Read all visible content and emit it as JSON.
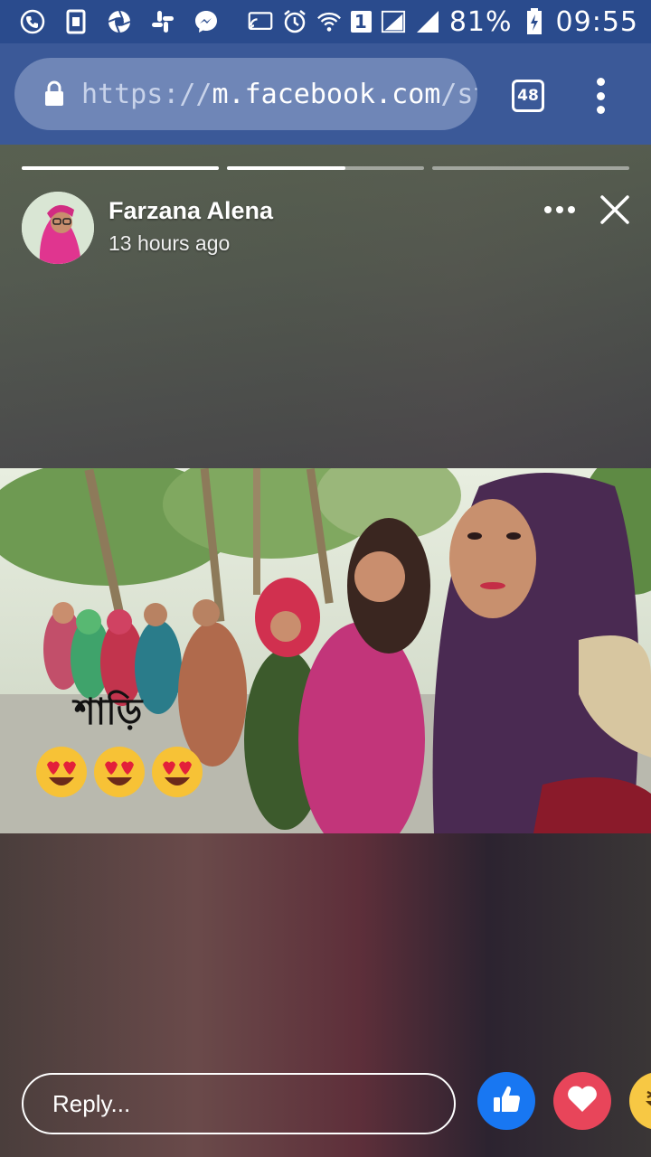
{
  "status_bar": {
    "battery": "81%",
    "time": "09:55",
    "sim_slot": "1"
  },
  "browser": {
    "url_scheme": "https://",
    "url_host": "m.facebook.com",
    "url_path": "/storie",
    "tab_count": "48"
  },
  "story": {
    "author": "Farzana Alena",
    "time_ago": "13 hours ago",
    "caption": "শাড়ি",
    "progress": [
      1.0,
      0.6,
      0.0
    ]
  },
  "reply": {
    "placeholder": "Reply..."
  },
  "colors": {
    "status_bar": "#2a4b8d",
    "browser_bar": "#3b5998",
    "like": "#1877f2",
    "love": "#e8455a",
    "haha": "#f7c844"
  }
}
